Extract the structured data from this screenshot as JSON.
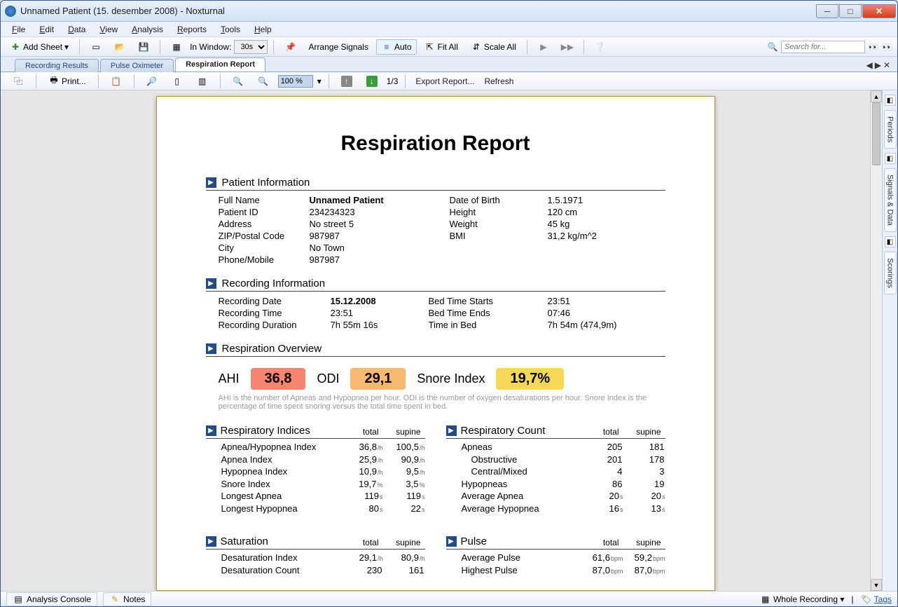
{
  "window": {
    "title": "Unnamed Patient (15. desember 2008)  - Noxturnal"
  },
  "menu": [
    "File",
    "Edit",
    "Data",
    "View",
    "Analysis",
    "Reports",
    "Tools",
    "Help"
  ],
  "toolbar": {
    "addSheet": "Add Sheet",
    "inWindowLabel": "In Window:",
    "inWindowValue": "30s",
    "arrange": "Arrange Signals",
    "auto": "Auto",
    "fitAll": "Fit All",
    "scaleAll": "Scale All",
    "searchPlaceholder": "Search for..."
  },
  "tabs": {
    "items": [
      "Recording Results",
      "Pulse Oximeter",
      "Respiration Report"
    ],
    "activeIndex": 2
  },
  "subtoolbar": {
    "print": "Print...",
    "zoom": "100 %",
    "pages": "1/3",
    "export": "Export Report...",
    "refresh": "Refresh"
  },
  "report": {
    "title": "Respiration Report",
    "sections": {
      "patient": {
        "heading": "Patient Information",
        "left": [
          {
            "label": "Full Name",
            "value": "Unnamed Patient",
            "bold": true
          },
          {
            "label": "Patient ID",
            "value": "234234323"
          },
          {
            "label": "Address",
            "value": "No street 5"
          },
          {
            "label": "ZIP/Postal Code",
            "value": "987987"
          },
          {
            "label": "City",
            "value": "No Town"
          },
          {
            "label": "Phone/Mobile",
            "value": "987987"
          }
        ],
        "right": [
          {
            "label": "Date of Birth",
            "value": "1.5.1971"
          },
          {
            "label": "Height",
            "value": "120 cm"
          },
          {
            "label": "Weight",
            "value": "45 kg"
          },
          {
            "label": "BMI",
            "value": "31,2 kg/m^2"
          }
        ]
      },
      "recording": {
        "heading": "Recording Information",
        "left": [
          {
            "label": "Recording Date",
            "value": "15.12.2008",
            "bold": true
          },
          {
            "label": "Recording Time",
            "value": "23:51"
          },
          {
            "label": "Recording Duration",
            "value": "7h 55m 16s"
          }
        ],
        "right": [
          {
            "label": "Bed Time Starts",
            "value": "23:51"
          },
          {
            "label": "Bed Time Ends",
            "value": "07:46"
          },
          {
            "label": "Time in Bed",
            "value": "7h 54m (474,9m)"
          }
        ]
      },
      "overview": {
        "heading": "Respiration Overview",
        "ahiLabel": "AHI",
        "ahi": "36,8",
        "odiLabel": "ODI",
        "odi": "29,1",
        "snoreLabel": "Snore Index",
        "snore": "19,7%",
        "note": "AHI is the number of Apneas and Hypopnea per hour. ODI is the number of oxygen desaturations per hour. Snore Index is the percentage of time spent snoring  versus the total time spent in bed."
      },
      "indices": {
        "heading": "Respiratory Indices",
        "cols": [
          "total",
          "supine"
        ],
        "rows": [
          {
            "name": "Apnea/Hypopnea Index",
            "t": "36,8",
            "tu": "/h",
            "s": "100,5",
            "su": "/h"
          },
          {
            "name": "Apnea Index",
            "t": "25,9",
            "tu": "/h",
            "s": "90,9",
            "su": "/h"
          },
          {
            "name": "Hypopnea Index",
            "t": "10,9",
            "tu": "/h",
            "s": "9,5",
            "su": "/h"
          },
          {
            "name": "Snore Index",
            "t": "19,7",
            "tu": "%",
            "s": "3,5",
            "su": "%"
          },
          {
            "name": "Longest Apnea",
            "t": "119",
            "tu": "s",
            "s": "119",
            "su": "s"
          },
          {
            "name": "Longest Hypopnea",
            "t": "80",
            "tu": "s",
            "s": "22",
            "su": "s"
          }
        ]
      },
      "count": {
        "heading": "Respiratory Count",
        "cols": [
          "total",
          "supine"
        ],
        "rows": [
          {
            "name": "Apneas",
            "t": "205",
            "tu": "",
            "s": "181",
            "su": ""
          },
          {
            "name": "Obstructive",
            "t": "201",
            "tu": "",
            "s": "178",
            "su": "",
            "indent": 1
          },
          {
            "name": "Central/Mixed",
            "t": "4",
            "tu": "",
            "s": "3",
            "su": "",
            "indent": 1
          },
          {
            "name": "Hypopneas",
            "t": "86",
            "tu": "",
            "s": "19",
            "su": ""
          },
          {
            "name": "Average Apnea",
            "t": "20",
            "tu": "s",
            "s": "20",
            "su": "s"
          },
          {
            "name": "Average Hypopnea",
            "t": "16",
            "tu": "s",
            "s": "13",
            "su": "s"
          }
        ]
      },
      "saturation": {
        "heading": "Saturation",
        "cols": [
          "total",
          "supine"
        ],
        "rows": [
          {
            "name": "Desaturation Index",
            "t": "29,1",
            "tu": "/h",
            "s": "80,9",
            "su": "/h"
          },
          {
            "name": "Desaturation Count",
            "t": "230",
            "tu": "",
            "s": "161",
            "su": ""
          }
        ]
      },
      "pulse": {
        "heading": "Pulse",
        "cols": [
          "total",
          "supine"
        ],
        "rows": [
          {
            "name": "Average Pulse",
            "t": "61,6",
            "tu": "bpm",
            "s": "59,2",
            "su": "bpm"
          },
          {
            "name": "Highest Pulse",
            "t": "87,0",
            "tu": "bpm",
            "s": "87,0",
            "su": "bpm"
          }
        ]
      }
    }
  },
  "rightTabs": [
    "Periods",
    "Signals & Data",
    "Scorings"
  ],
  "status": {
    "console": "Analysis Console",
    "notes": "Notes",
    "recording": "Whole Recording",
    "tags": "Tags"
  }
}
